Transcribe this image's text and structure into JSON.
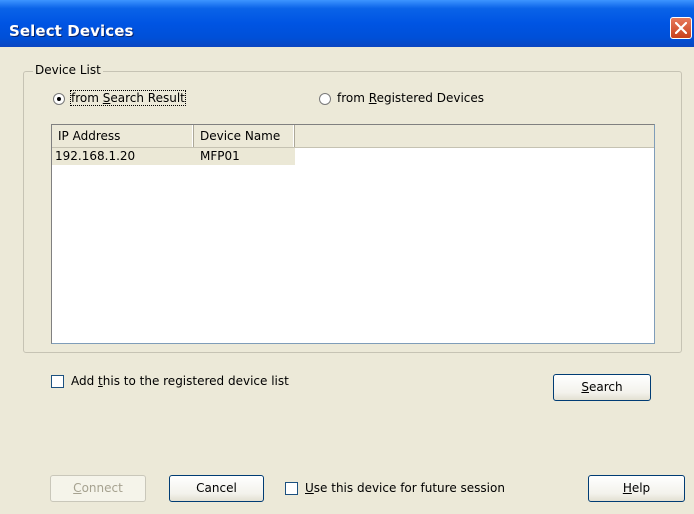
{
  "window": {
    "title": "Select Devices",
    "close_icon": "close-icon"
  },
  "group": {
    "label": "Device List"
  },
  "radios": {
    "search_result": {
      "label_pre": "from ",
      "label_u": "S",
      "label_post": "earch Result",
      "checked": true
    },
    "registered": {
      "label_pre": "from ",
      "label_u": "R",
      "label_post": "egistered Devices",
      "checked": false
    }
  },
  "list": {
    "columns": [
      "IP Address",
      "Device Name"
    ],
    "rows": [
      {
        "ip": "192.168.1.20",
        "name": "MFP01"
      }
    ]
  },
  "add_registered": {
    "label_pre": "Add ",
    "label_u": "t",
    "label_post": "his to the registered device list",
    "checked": false
  },
  "buttons": {
    "search": {
      "u": "S",
      "rest": "earch"
    },
    "connect": {
      "u": "C",
      "rest": "onnect",
      "enabled": false
    },
    "cancel": "Cancel",
    "help": {
      "u": "H",
      "rest": "elp"
    }
  },
  "future_session": {
    "label_u": "U",
    "label_post": "se this device for future session",
    "checked": false
  }
}
